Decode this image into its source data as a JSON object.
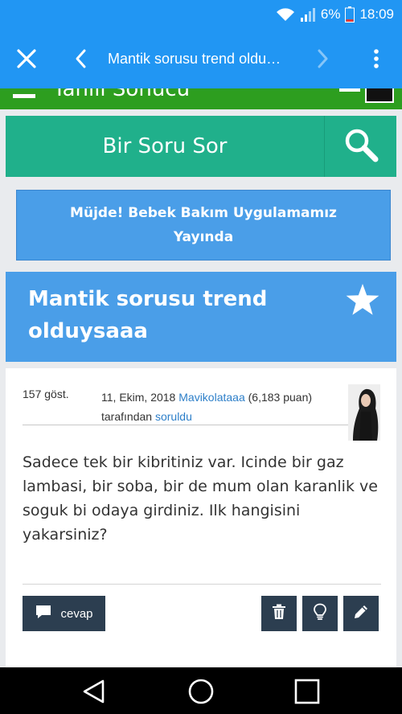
{
  "status_bar": {
    "battery": "6%",
    "time": "18:09"
  },
  "app_bar": {
    "title": "Mantik sorusu trend oldu…"
  },
  "site_header": {
    "name": "Tahlil Sonucu"
  },
  "ask": {
    "label": "Bir Soru Sor"
  },
  "promo": {
    "text": "Müjde! Bebek Bakım Uygulamamız Yayında"
  },
  "question": {
    "title": "Mantik sorusu trend olduysaaa",
    "views": "157 göst.",
    "date": "11, Ekim, 2018",
    "author": "Mavikolataaa",
    "author_points": "(6,183 puan)",
    "by_text": "tarafından",
    "action": "soruldu",
    "body": "Sadece tek bir kibritiniz var. Icinde bir gaz lambasi, bir soba, bir de mum olan karanlik ve soguk bi odaya girdiniz. Ilk hangisini yakarsiniz?"
  },
  "actions": {
    "answer_label": "cevap"
  },
  "colors": {
    "primary": "#2196f3",
    "green": "#2d9e1f",
    "teal": "#20b08b",
    "blue_panel": "#4a9ee8",
    "dark_button": "#2c3e50",
    "link": "#2d7fc9"
  },
  "icons": [
    "wifi-icon",
    "signal-icon",
    "battery-icon",
    "close-icon",
    "back-icon",
    "forward-icon",
    "more-icon",
    "menu-icon",
    "search-icon",
    "star-icon",
    "comment-icon",
    "trash-icon",
    "lightbulb-icon",
    "pencil-icon",
    "nav-back-icon",
    "nav-home-icon",
    "nav-recents-icon"
  ]
}
